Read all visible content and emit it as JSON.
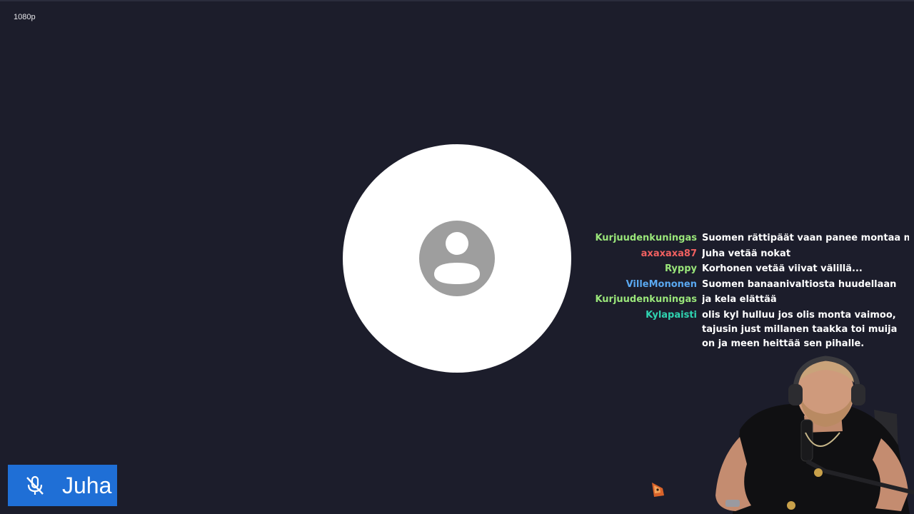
{
  "stream": {
    "quality_label": "1080p"
  },
  "participant": {
    "name": "Juha",
    "mic_icon": "mic-muted-icon",
    "nameplate_color": "#1f6fd6"
  },
  "avatar": {
    "icon": "user-placeholder-icon"
  },
  "chat": {
    "messages": [
      {
        "user": "Kurjuudenkuningas",
        "color": "#9ae67a",
        "text": "Suomen rättipäät vaan panee montaa my"
      },
      {
        "user": "axaxaxa87",
        "color": "#f06060",
        "text": "Juha vetää nokat"
      },
      {
        "user": "Ryppy",
        "color": "#9ae67a",
        "text": "Korhonen vetää viivat välillä..."
      },
      {
        "user": "VilleMononen",
        "color": "#5aa8f0",
        "text": "Suomen banaanivaltiosta huudellaan"
      },
      {
        "user": "Kurjuudenkuningas",
        "color": "#9ae67a",
        "text": "ja kela elättää"
      },
      {
        "user": "Kylapaisti",
        "color": "#2fd3b0",
        "text": "olis kyl hulluu jos olis monta vaimoo, tajusin just millanen taakka toi muija on ja meen heittää sen pihalle."
      }
    ]
  }
}
